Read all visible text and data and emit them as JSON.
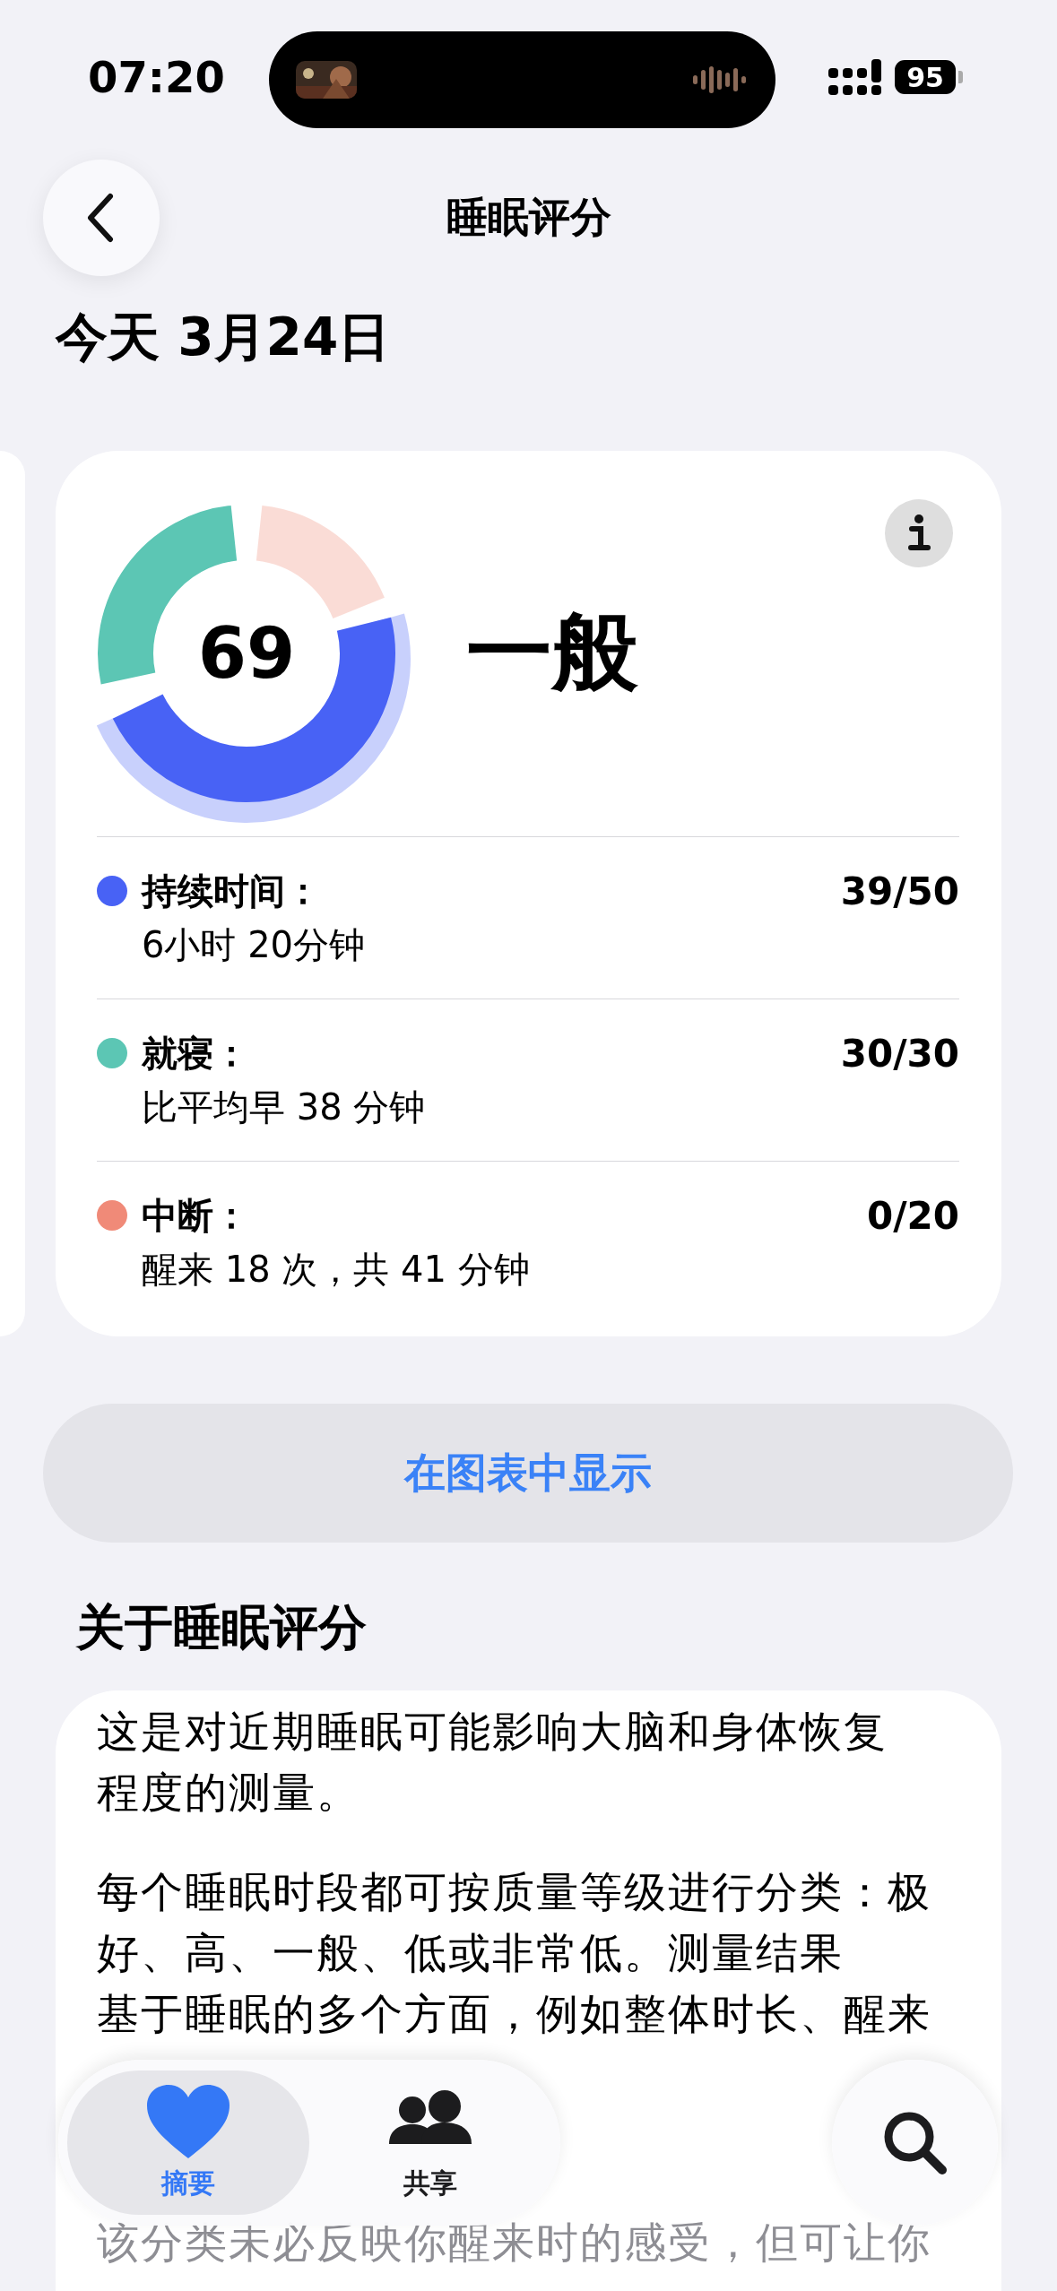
{
  "status_bar": {
    "time": "07:20",
    "battery": "95"
  },
  "nav": {
    "title": "睡眠评分"
  },
  "date": "今天 3月24日",
  "score_card": {
    "score": "69",
    "rating": "一般",
    "components": [
      {
        "label": "持续时间：",
        "detail": "6小时 20分钟",
        "score": "39/50",
        "color": "#4862f5",
        "ring_dimmed": false,
        "emphasized": true
      },
      {
        "label": "就寝：",
        "detail": "比平均早 38 分钟",
        "score": "30/30",
        "color": "#5cc6b4",
        "ring_dimmed": false,
        "emphasized": false
      },
      {
        "label": "中断：",
        "detail": "醒来 18 次，共 41 分钟",
        "score": "0/20",
        "color": "#f08a78",
        "ring_dimmed": true,
        "emphasized": false
      }
    ]
  },
  "chart_button": "在图表中显示",
  "about": {
    "heading": "关于睡眠评分",
    "paragraphs": [
      {
        "lines": [
          "这是对近期睡眠可能影响大脑和身体恢复",
          "程度的测量。"
        ],
        "dimmed": false
      },
      {
        "lines": [
          "每个睡眠时段都可按质量等级进行分类：极",
          "好、高、一般、低或非常低。测量结果",
          "基于睡眠的多个方面，例如整体时长、醒来"
        ],
        "dimmed": false
      },
      {
        "lines": [
          "该分类未必反映你醒来时的感受，但可让你"
        ],
        "dimmed": true
      }
    ]
  },
  "tab_bar": {
    "tabs": [
      {
        "label": "摘要",
        "kind": "summary",
        "selected": true
      },
      {
        "label": "共享",
        "kind": "sharing",
        "selected": false
      }
    ]
  }
}
